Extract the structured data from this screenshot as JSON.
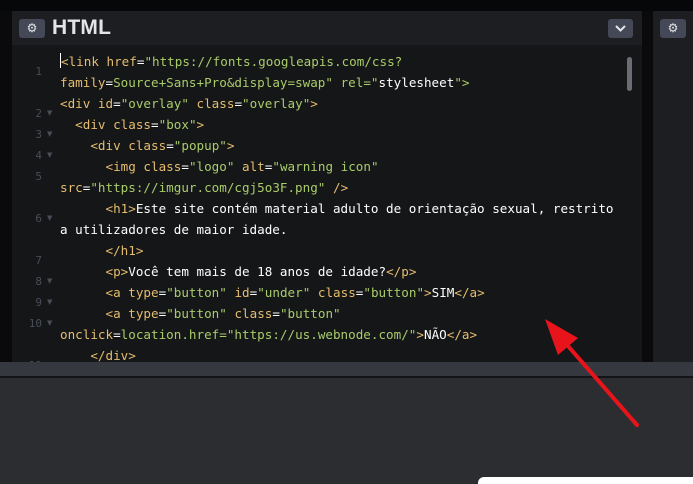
{
  "panels": {
    "main": {
      "title": "HTML",
      "settings_icon": "gear-icon",
      "collapse_icon": "chevron-down-icon"
    },
    "right": {
      "settings_icon": "gear-icon"
    }
  },
  "editor": {
    "line_numbers": [
      "1",
      "2",
      "3",
      "4",
      "5",
      "6",
      "7",
      "8",
      "9",
      "10",
      "11"
    ],
    "code_lines": [
      [
        "<link href=\"https://fonts.googleapis.com/css?"
      ],
      [
        "family=Source+Sans+Pro&display=swap\" rel=\"stylesheet\">"
      ],
      [
        "<div id=\"overlay\" class=\"overlay\">"
      ],
      [
        "  <div class=\"box\">"
      ],
      [
        "    <div class=\"popup\">"
      ],
      [
        "      <img class=\"logo\" alt=\"warning icon\""
      ],
      [
        "src=\"https://imgur.com/cgj5o3F.png\" />"
      ],
      [
        "      <h1>Este site contém material adulto de orientação sexual, restrito"
      ],
      [
        "a utilizadores de maior idade."
      ],
      [
        "      </h1>"
      ],
      [
        "      <p>Você tem mais de 18 anos de idade?</p>"
      ],
      [
        "      <a type=\"button\" id=\"under\" class=\"button\">SIM</a>"
      ],
      [
        "      <a type=\"button\" class=\"button\""
      ],
      [
        "onclick=location.href=\"https://us.webnode.com/\">NÃO</a>"
      ],
      [
        "    </div>"
      ]
    ]
  },
  "colors": {
    "tag": "#e5bd6e",
    "attr": "#a9cc6a",
    "arrow": "#e8141c"
  }
}
